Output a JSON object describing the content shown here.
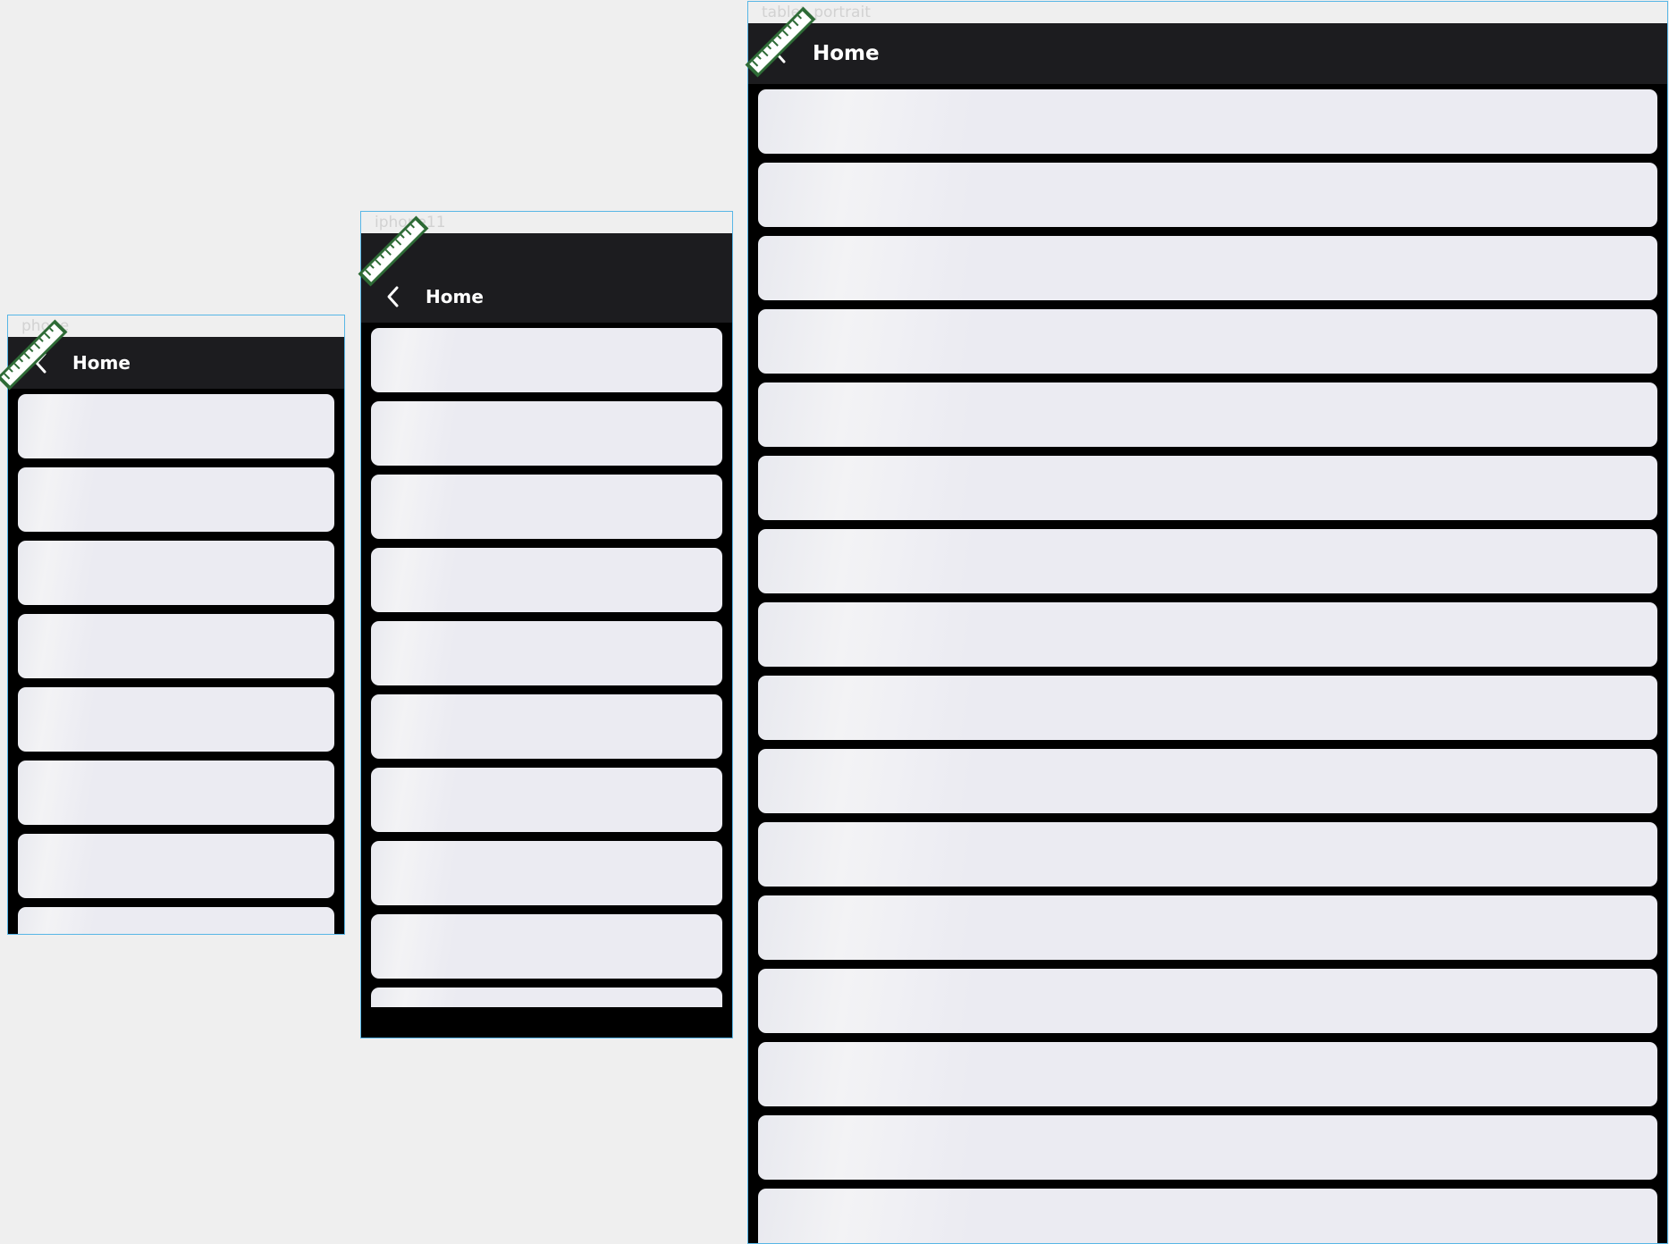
{
  "frames": [
    {
      "id": "phone",
      "label": "phone",
      "title": "Home",
      "card_count": 8
    },
    {
      "id": "iphone11",
      "label": "iphone11",
      "title": "Home",
      "card_count": 10
    },
    {
      "id": "tablet-portrait",
      "label": "tablet_portrait",
      "title": "Home",
      "card_count": 16
    }
  ],
  "icons": {
    "back": "chevron-left-icon",
    "debug": "debug-ruler-badge-icon"
  },
  "colors": {
    "background": "#efefef",
    "frame_border": "#58b6e6",
    "appbar": "#1c1c1f",
    "card": "#ebebf2",
    "title": "#ffffff",
    "badge": "#2e6b36"
  }
}
